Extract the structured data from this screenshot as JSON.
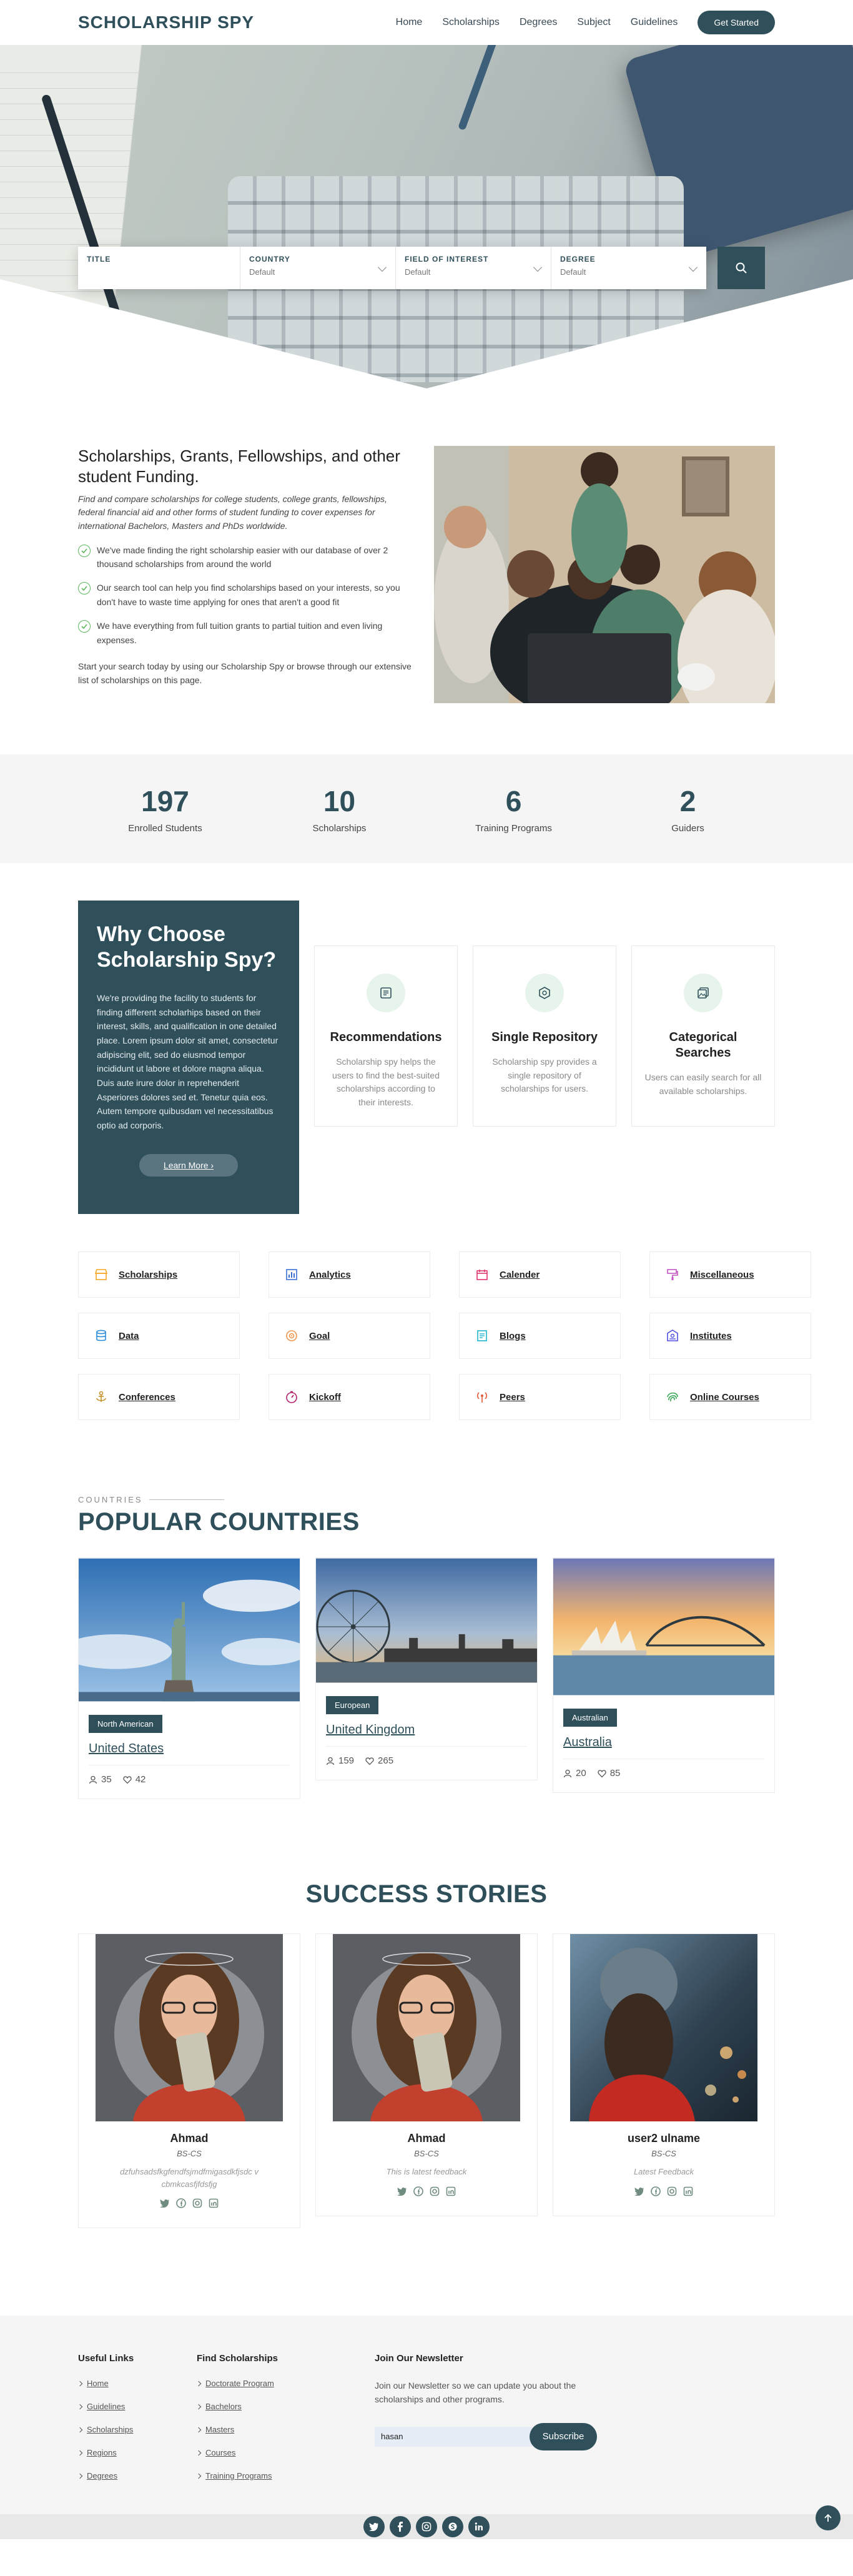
{
  "nav": {
    "logo": "SCHOLARSHIP SPY",
    "links": [
      "Home",
      "Scholarships",
      "Degrees",
      "Subject",
      "Guidelines"
    ],
    "cta": "Get Started"
  },
  "search": {
    "fields": [
      {
        "label": "TITLE",
        "value": ""
      },
      {
        "label": "COUNTRY",
        "value": "Default"
      },
      {
        "label": "FIELD OF INTEREST",
        "value": "Default"
      },
      {
        "label": "DEGREE",
        "value": "Default"
      }
    ]
  },
  "intro": {
    "title": "Scholarships, Grants, Fellowships, and other student Funding.",
    "subtitle": "Find and compare scholarships for college students, college grants, fellowships, federal financial aid and other forms of student funding to cover expenses for international Bachelors, Masters and PhDs worldwide.",
    "checks": [
      "We've made finding the right scholarship easier with our database of over 2 thousand scholarships from around the world",
      "Our search tool can help you find scholarships based on your interests, so you don't have to waste time applying for ones that aren't a good fit",
      "We have everything from full tuition grants to partial tuition and even living expenses."
    ],
    "closing": "Start your search today by using our Scholarship Spy or browse through our extensive list of scholarships on this page."
  },
  "stats": [
    {
      "num": "197",
      "cap": "Enrolled Students"
    },
    {
      "num": "10",
      "cap": "Scholarships"
    },
    {
      "num": "6",
      "cap": "Training Programs"
    },
    {
      "num": "2",
      "cap": "Guiders"
    }
  ],
  "why": {
    "title": "Why Choose Scholarship Spy?",
    "body": "We're providing the facility to students for finding different scholarhips based on their interest, skills, and qualification in one detailed place. Lorem ipsum dolor sit amet, consectetur adipiscing elit, sed do eiusmod tempor incididunt ut labore et dolore magna aliqua. Duis aute irure dolor in reprehenderit Asperiores dolores sed et. Tenetur quia eos. Autem tempore quibusdam vel necessitatibus optio ad corporis.",
    "button": "Learn More"
  },
  "features": [
    {
      "title": "Recommendations",
      "text": "Scholarship spy helps the users to find the best-suited scholarships according to their interests.",
      "icon": "document-icon"
    },
    {
      "title": "Single Repository",
      "text": "Scholarship spy provides a single repository of scholarships for users.",
      "icon": "repository-icon"
    },
    {
      "title": "Categorical Searches",
      "text": "Users can easily search for all available scholarships.",
      "icon": "images-icon"
    }
  ],
  "categories": [
    {
      "label": "Scholarships",
      "color": "#f5a623",
      "icon": "store-icon"
    },
    {
      "label": "Analytics",
      "color": "#3b6fd6",
      "icon": "bar-chart-icon"
    },
    {
      "label": "Calender",
      "color": "#e0356b",
      "icon": "calendar-icon"
    },
    {
      "label": "Miscellaneous",
      "color": "#c154c1",
      "icon": "paint-roller-icon"
    },
    {
      "label": "Data",
      "color": "#2a8bd8",
      "icon": "database-icon"
    },
    {
      "label": "Goal",
      "color": "#f0944d",
      "icon": "target-icon"
    },
    {
      "label": "Blogs",
      "color": "#1bb6c9",
      "icon": "blog-icon"
    },
    {
      "label": "Institutes",
      "color": "#4f4fe0",
      "icon": "institute-icon"
    },
    {
      "label": "Conferences",
      "color": "#c7922b",
      "icon": "anchor-icon"
    },
    {
      "label": "Kickoff",
      "color": "#b0206b",
      "icon": "stopwatch-icon"
    },
    {
      "label": "Peers",
      "color": "#e05a3a",
      "icon": "broadcast-icon"
    },
    {
      "label": "Online Courses",
      "color": "#3ca85a",
      "icon": "fingerprint-icon"
    }
  ],
  "countries": {
    "eyebrow": "COUNTRIES",
    "title": "POPULAR COUNTRIES",
    "items": [
      {
        "badge": "North American",
        "name": "United States",
        "users": "35",
        "likes": "42"
      },
      {
        "badge": "European",
        "name": "United Kingdom",
        "users": "159",
        "likes": "265"
      },
      {
        "badge": "Australian",
        "name": "Australia",
        "users": "20",
        "likes": "85"
      }
    ]
  },
  "success": {
    "title": "SUCCESS STORIES",
    "items": [
      {
        "name": "Ahmad",
        "degree": "BS-CS",
        "feedback": "dzfuhsadsfkgfendfsjmdfmigasdkfjsdc v cbmkcasfjfdsfjg"
      },
      {
        "name": "Ahmad",
        "degree": "BS-CS",
        "feedback": "This is latest feedback"
      },
      {
        "name": "user2 ulname",
        "degree": "BS-CS",
        "feedback": "Latest Feedback"
      }
    ]
  },
  "footer": {
    "useful_title": "Useful Links",
    "useful": [
      "Home",
      "Guidelines",
      "Scholarships",
      "Regions",
      "Degrees"
    ],
    "find_title": "Find Scholarships",
    "find": [
      "Doctorate Program",
      "Bachelors",
      "Masters",
      "Courses",
      "Training Programs"
    ],
    "news_title": "Join Our Newsletter",
    "news_text": "Join our Newsletter so we can update you about the scholarships and other programs.",
    "news_value": "hasan",
    "news_button": "Subscribe"
  },
  "colors": {
    "brand": "#2f4f5a",
    "check": "#5cb85c",
    "feature_icon_bg": "#e6f4ec"
  }
}
